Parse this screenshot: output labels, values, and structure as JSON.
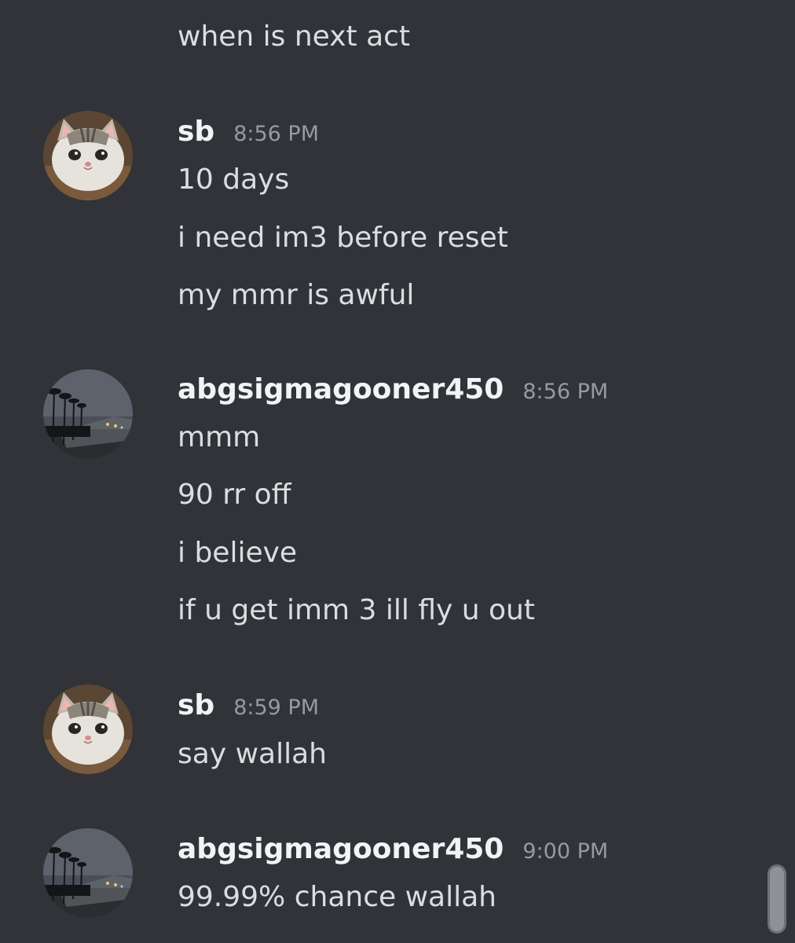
{
  "continuation": {
    "lines": [
      "when is next act"
    ]
  },
  "messages": [
    {
      "username": "sb",
      "timestamp": "8:56 PM",
      "avatar": "cat-avatar",
      "lines": [
        "10 days",
        "i need im3 before reset",
        "my mmr is awful"
      ]
    },
    {
      "username": "abgsigmagooner450",
      "timestamp": "8:56 PM",
      "avatar": "night-palms-avatar",
      "lines": [
        "mmm",
        "90 rr off",
        "i believe",
        "if u get imm 3 ill fly u out"
      ]
    },
    {
      "username": "sb",
      "timestamp": "8:59 PM",
      "avatar": "cat-avatar",
      "lines": [
        "say wallah"
      ]
    },
    {
      "username": "abgsigmagooner450",
      "timestamp": "9:00 PM",
      "avatar": "night-palms-avatar",
      "lines": [
        "99.99% chance wallah"
      ]
    }
  ],
  "colors": {
    "background": "#313338",
    "text": "#dbdee1",
    "username": "#f2f3f5",
    "timestamp": "#949ba4"
  }
}
